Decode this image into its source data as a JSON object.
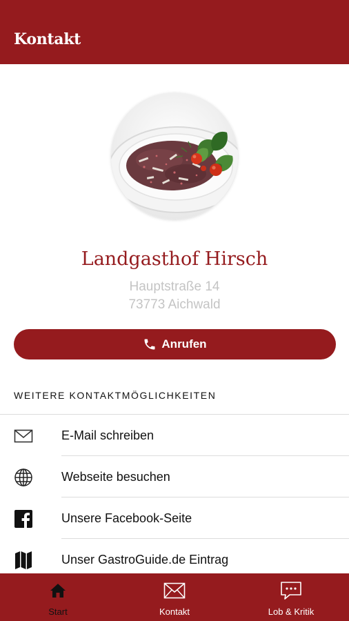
{
  "header": {
    "title": "Kontakt"
  },
  "restaurant": {
    "name": "Landgasthof Hirsch",
    "street": "Hauptstraße 14",
    "city": "73773 Aichwald"
  },
  "call_button": {
    "label": "Anrufen",
    "icon": "phone-icon"
  },
  "contact_section": {
    "title": "WEITERE KONTAKTMÖGLICHKEITEN",
    "items": [
      {
        "label": "E-Mail schreiben",
        "icon": "mail-icon"
      },
      {
        "label": "Webseite besuchen",
        "icon": "globe-icon"
      },
      {
        "label": "Unsere Facebook-Seite",
        "icon": "facebook-icon"
      },
      {
        "label": "Unser GastroGuide.de Eintrag",
        "icon": "map-icon"
      }
    ]
  },
  "tabbar": {
    "tabs": [
      {
        "label": "Start",
        "icon": "home-icon",
        "active": true
      },
      {
        "label": "Kontakt",
        "icon": "mail-icon",
        "active": false
      },
      {
        "label": "Lob & Kritik",
        "icon": "chat-icon",
        "active": false
      }
    ]
  },
  "colors": {
    "brand": "#951b1e",
    "active_tab_text": "#111111",
    "inactive_tab_text": "#ffffff",
    "address_text": "#c4c4c4"
  }
}
